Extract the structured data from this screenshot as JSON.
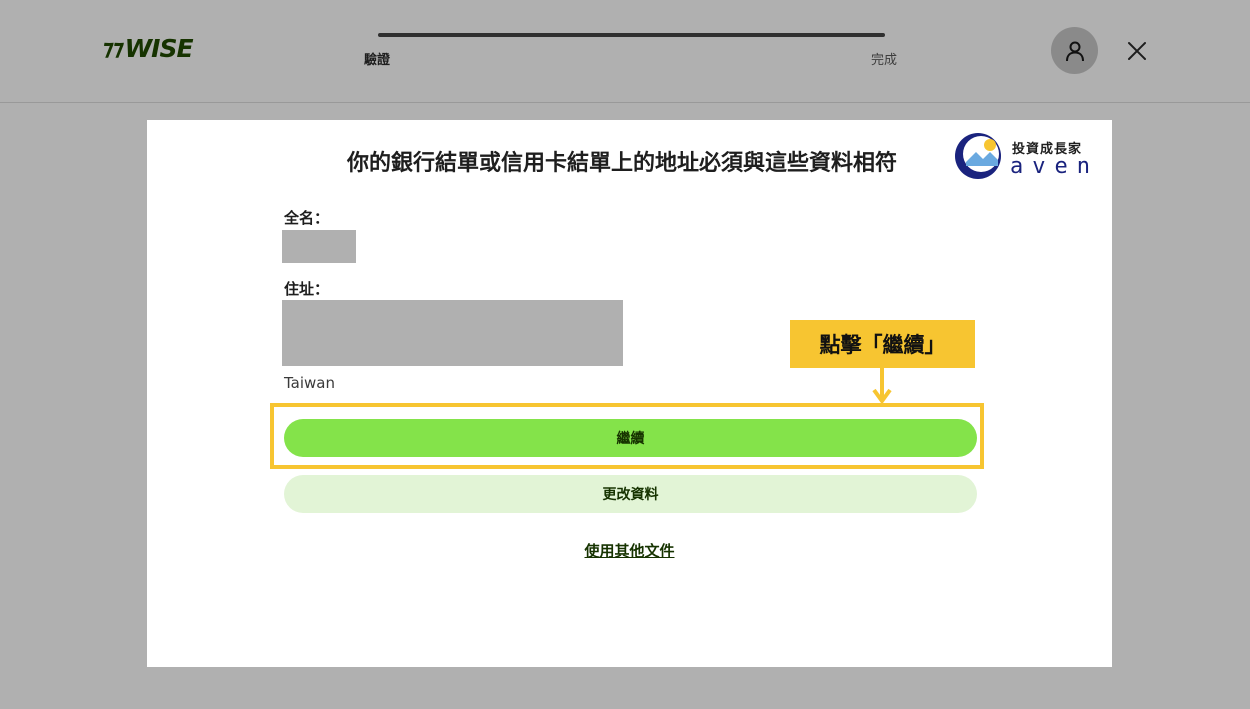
{
  "header": {
    "logo_text": "WISE",
    "logo_mark": "⁊⁊",
    "steps": [
      {
        "label": "驗證",
        "active": true
      },
      {
        "label": "完成",
        "active": false
      }
    ],
    "progress_fraction": 1.0,
    "user_icon": "user-icon",
    "close_icon": "close-icon"
  },
  "panel": {
    "title": "你的銀行結單或信用卡結單上的地址必須與這些資料相符",
    "name_label": "全名：",
    "address_label": "住址：",
    "country": "Taiwan",
    "continue_label": "繼續",
    "edit_label": "更改資料",
    "other_doc_link": "使用其他文件"
  },
  "annotation": {
    "callout_text": "點擊「繼續」"
  },
  "watermark": {
    "top_text": "投資成長家",
    "bottom_text": "aven"
  },
  "colors": {
    "brand_green": "#84e34a",
    "brand_dark_green": "#163300",
    "light_green": "#e2f4d6",
    "annotation_yellow": "#f7c531",
    "overlay_gray": "#b0b0b0"
  }
}
